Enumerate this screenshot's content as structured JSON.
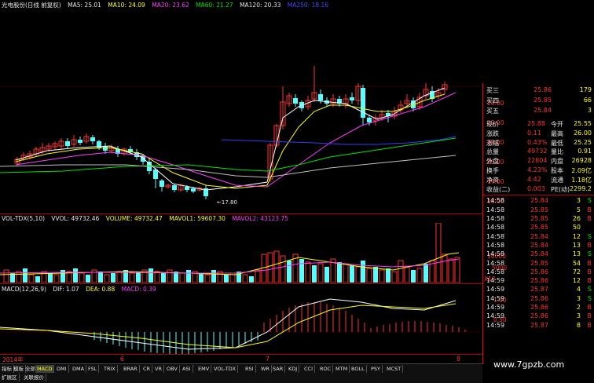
{
  "main_legend": {
    "title": "光电股份(日线 前复权)",
    "ma5": "MA5: 25.01",
    "ma10": "MA10: 24.09",
    "ma20": "MA20: 23.62",
    "ma60": "MA60: 21.27",
    "ma120": "MA120: 20.33",
    "ma250": "MA250: 18.16"
  },
  "price_axis": [
    "23.00",
    "22.00",
    "21.00",
    "20.00",
    "19.00",
    "18.00"
  ],
  "low_marker": "17.80",
  "vol_legend": {
    "name": "VOL-TDX(5,10)",
    "vvol": "VVOL: 49732.46",
    "volume": "VOLUME: 49732.47",
    "mavol1": "MAVOL1: 59607.30",
    "mavol2": "MAVOL2: 43123.75"
  },
  "vol_axis": [
    "10000",
    "5000",
    "X10"
  ],
  "macd_legend": {
    "name": "MACD(12,26,9)",
    "dif": "DIF: 1.07",
    "dea": "DEA: 0.88",
    "macd": "MACD: 0.39"
  },
  "macd_axis": [
    "1.00",
    "0.50"
  ],
  "date_axis": {
    "year": "2014年",
    "m6": "6",
    "m7": "7",
    "m8": "8"
  },
  "quote": {
    "bids": [
      {
        "label": "买三",
        "price": "25.86",
        "vol": "179"
      },
      {
        "label": "买四",
        "price": "25.85",
        "vol": "66"
      },
      {
        "label": "买五",
        "price": "25.84",
        "vol": "3"
      }
    ],
    "stats": [
      {
        "l1": "现价",
        "v1": "25.88",
        "l2": "今开",
        "v2": "25.55"
      },
      {
        "l1": "涨跌",
        "v1": "0.11",
        "l2": "最高",
        "v2": "26.00"
      },
      {
        "l1": "涨幅",
        "v1": "0.43%",
        "l2": "最低",
        "v2": "25.25"
      },
      {
        "l1": "总量",
        "v1": "49732",
        "l2": "量比",
        "v2": "0.91"
      },
      {
        "l1": "外盘",
        "v1": "22804",
        "l2": "内盘",
        "v2": "26928"
      },
      {
        "l1": "换手",
        "v1": "4.23%",
        "l2": "股本",
        "v2": "2.09亿"
      },
      {
        "l1": "净资",
        "v1": "4.42",
        "l2": "流通",
        "v2": "1.18亿"
      },
      {
        "l1": "收益(二)",
        "v1": "0.003",
        "l2": "PE(动)",
        "v2": "2299.2"
      }
    ],
    "ticks": [
      {
        "time": "14:58",
        "price": "25.84",
        "vol": "3",
        "side": "S"
      },
      {
        "time": "14:58",
        "price": "25.85",
        "vol": "5",
        "side": "B"
      },
      {
        "time": "14:58",
        "price": "25.85",
        "vol": "26",
        "side": "B"
      },
      {
        "time": "14:58",
        "price": "25.85",
        "vol": "50",
        "side": ""
      },
      {
        "time": "14:58",
        "price": "25.84",
        "vol": "12",
        "side": "S"
      },
      {
        "time": "14:58",
        "price": "25.84",
        "vol": "13",
        "side": "B"
      },
      {
        "time": "14:58",
        "price": "25.84",
        "vol": "13",
        "side": "S"
      },
      {
        "time": "14:58",
        "price": "25.85",
        "vol": "54",
        "side": "B"
      },
      {
        "time": "14:58",
        "price": "25.86",
        "vol": "72",
        "side": "B"
      },
      {
        "time": "14:59",
        "price": "25.86",
        "vol": "12",
        "side": "B"
      },
      {
        "time": "14:59",
        "price": "25.87",
        "vol": "4",
        "side": "S"
      },
      {
        "time": "14:59",
        "price": "25.86",
        "vol": "3",
        "side": "S"
      },
      {
        "time": "14:59",
        "price": "25.86",
        "vol": "2",
        "side": "B"
      },
      {
        "time": "14:59",
        "price": "25.86",
        "vol": "3",
        "side": "B"
      },
      {
        "time": "14:59",
        "price": "25.87",
        "vol": "8",
        "side": "B"
      }
    ]
  },
  "tabs": [
    "指标",
    "模板",
    "全部",
    "MACD",
    "DMI",
    "DMA",
    "FSL",
    "TRIX",
    "BRAR",
    "CR",
    "VR",
    "OBV",
    "ASI",
    "EMV",
    "VOL-TDX",
    "RSI",
    "WR",
    "SAR",
    "KDJ",
    "CCI",
    "ROC",
    "MTM",
    "BOLL",
    "PSY",
    "MCST"
  ],
  "bottom_tabs": [
    "扩展区",
    "关联报价"
  ],
  "watermark": "www.7gpzb.com",
  "colors": {
    "up": "#ff3232",
    "down": "#54ffff",
    "ma5": "#ffffff",
    "ma10": "#ffff00",
    "ma20": "#ff3cff",
    "ma60": "#00e600",
    "ma120": "#c0c0c0",
    "ma250": "#3a3aff"
  }
}
